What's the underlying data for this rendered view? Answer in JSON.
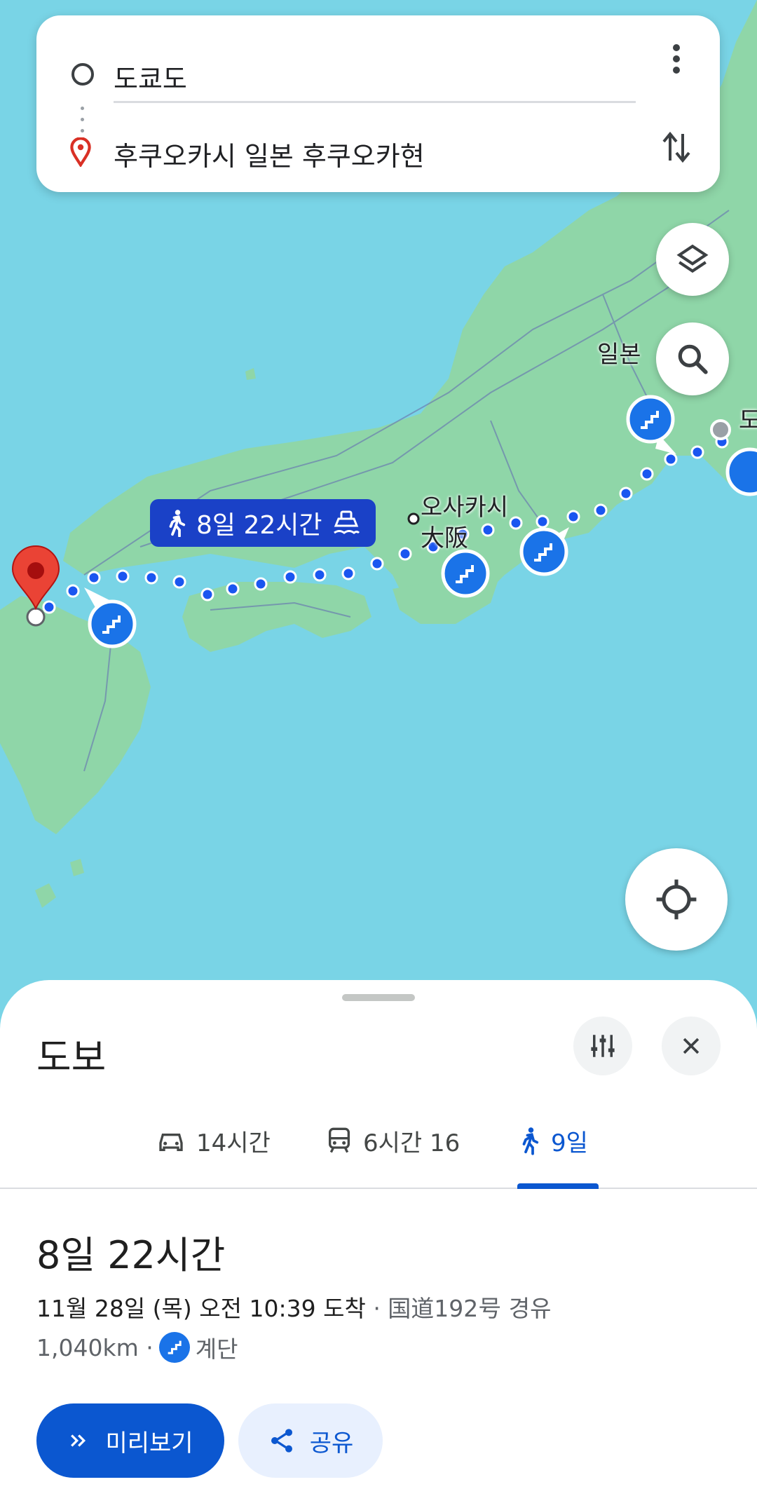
{
  "search_card": {
    "origin": "도쿄도",
    "destination": "후쿠오카시 일본 후쿠오카현"
  },
  "map": {
    "labels": {
      "japan": "일본",
      "osaka_ko": "오사카시",
      "osaka_ja": "大阪",
      "tokyo_partial": "도"
    },
    "route_label": "8일 22시간"
  },
  "sheet": {
    "mode_title": "도보",
    "tabs": [
      {
        "label": "14시간",
        "icon": "car-icon"
      },
      {
        "label": "6시간 16",
        "icon": "train-icon"
      },
      {
        "label": "9일",
        "icon": "walk-icon",
        "active": true
      }
    ],
    "duration": "8일 22시간",
    "arrival": "11월 28일 (목) 오전 10:39 도착",
    "via": "· 国道192号 경유",
    "distance": "1,040km ·",
    "stairs_label": "계단",
    "preview_button": "미리보기",
    "share_button": "공유"
  },
  "colors": {
    "water": "#79d4e6",
    "land": "#8fd6a8",
    "route": "#1a56f0",
    "primary": "#0b57d0",
    "destination_pin": "#d93025"
  }
}
